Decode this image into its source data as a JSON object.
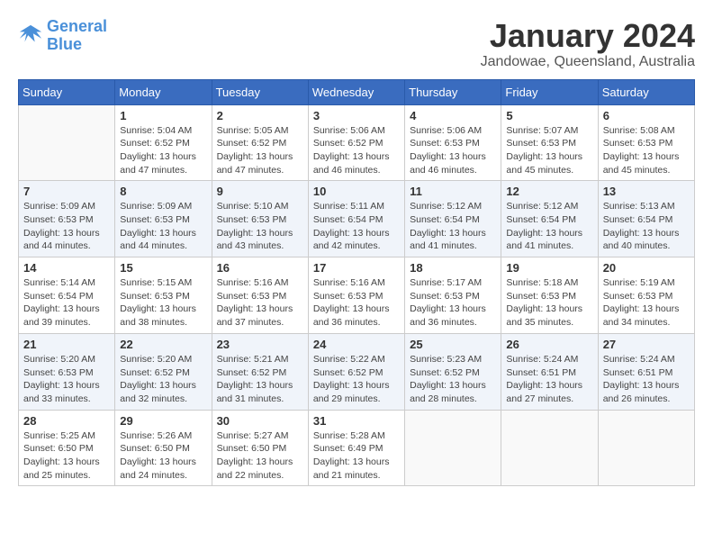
{
  "logo": {
    "text_general": "General",
    "text_blue": "Blue"
  },
  "header": {
    "title": "January 2024",
    "subtitle": "Jandowae, Queensland, Australia"
  },
  "weekdays": [
    "Sunday",
    "Monday",
    "Tuesday",
    "Wednesday",
    "Thursday",
    "Friday",
    "Saturday"
  ],
  "weeks": [
    [
      {
        "day": "",
        "sunrise": "",
        "sunset": "",
        "daylight": ""
      },
      {
        "day": "1",
        "sunrise": "Sunrise: 5:04 AM",
        "sunset": "Sunset: 6:52 PM",
        "daylight": "Daylight: 13 hours and 47 minutes."
      },
      {
        "day": "2",
        "sunrise": "Sunrise: 5:05 AM",
        "sunset": "Sunset: 6:52 PM",
        "daylight": "Daylight: 13 hours and 47 minutes."
      },
      {
        "day": "3",
        "sunrise": "Sunrise: 5:06 AM",
        "sunset": "Sunset: 6:52 PM",
        "daylight": "Daylight: 13 hours and 46 minutes."
      },
      {
        "day": "4",
        "sunrise": "Sunrise: 5:06 AM",
        "sunset": "Sunset: 6:53 PM",
        "daylight": "Daylight: 13 hours and 46 minutes."
      },
      {
        "day": "5",
        "sunrise": "Sunrise: 5:07 AM",
        "sunset": "Sunset: 6:53 PM",
        "daylight": "Daylight: 13 hours and 45 minutes."
      },
      {
        "day": "6",
        "sunrise": "Sunrise: 5:08 AM",
        "sunset": "Sunset: 6:53 PM",
        "daylight": "Daylight: 13 hours and 45 minutes."
      }
    ],
    [
      {
        "day": "7",
        "sunrise": "Sunrise: 5:09 AM",
        "sunset": "Sunset: 6:53 PM",
        "daylight": "Daylight: 13 hours and 44 minutes."
      },
      {
        "day": "8",
        "sunrise": "Sunrise: 5:09 AM",
        "sunset": "Sunset: 6:53 PM",
        "daylight": "Daylight: 13 hours and 44 minutes."
      },
      {
        "day": "9",
        "sunrise": "Sunrise: 5:10 AM",
        "sunset": "Sunset: 6:53 PM",
        "daylight": "Daylight: 13 hours and 43 minutes."
      },
      {
        "day": "10",
        "sunrise": "Sunrise: 5:11 AM",
        "sunset": "Sunset: 6:54 PM",
        "daylight": "Daylight: 13 hours and 42 minutes."
      },
      {
        "day": "11",
        "sunrise": "Sunrise: 5:12 AM",
        "sunset": "Sunset: 6:54 PM",
        "daylight": "Daylight: 13 hours and 41 minutes."
      },
      {
        "day": "12",
        "sunrise": "Sunrise: 5:12 AM",
        "sunset": "Sunset: 6:54 PM",
        "daylight": "Daylight: 13 hours and 41 minutes."
      },
      {
        "day": "13",
        "sunrise": "Sunrise: 5:13 AM",
        "sunset": "Sunset: 6:54 PM",
        "daylight": "Daylight: 13 hours and 40 minutes."
      }
    ],
    [
      {
        "day": "14",
        "sunrise": "Sunrise: 5:14 AM",
        "sunset": "Sunset: 6:54 PM",
        "daylight": "Daylight: 13 hours and 39 minutes."
      },
      {
        "day": "15",
        "sunrise": "Sunrise: 5:15 AM",
        "sunset": "Sunset: 6:53 PM",
        "daylight": "Daylight: 13 hours and 38 minutes."
      },
      {
        "day": "16",
        "sunrise": "Sunrise: 5:16 AM",
        "sunset": "Sunset: 6:53 PM",
        "daylight": "Daylight: 13 hours and 37 minutes."
      },
      {
        "day": "17",
        "sunrise": "Sunrise: 5:16 AM",
        "sunset": "Sunset: 6:53 PM",
        "daylight": "Daylight: 13 hours and 36 minutes."
      },
      {
        "day": "18",
        "sunrise": "Sunrise: 5:17 AM",
        "sunset": "Sunset: 6:53 PM",
        "daylight": "Daylight: 13 hours and 36 minutes."
      },
      {
        "day": "19",
        "sunrise": "Sunrise: 5:18 AM",
        "sunset": "Sunset: 6:53 PM",
        "daylight": "Daylight: 13 hours and 35 minutes."
      },
      {
        "day": "20",
        "sunrise": "Sunrise: 5:19 AM",
        "sunset": "Sunset: 6:53 PM",
        "daylight": "Daylight: 13 hours and 34 minutes."
      }
    ],
    [
      {
        "day": "21",
        "sunrise": "Sunrise: 5:20 AM",
        "sunset": "Sunset: 6:53 PM",
        "daylight": "Daylight: 13 hours and 33 minutes."
      },
      {
        "day": "22",
        "sunrise": "Sunrise: 5:20 AM",
        "sunset": "Sunset: 6:52 PM",
        "daylight": "Daylight: 13 hours and 32 minutes."
      },
      {
        "day": "23",
        "sunrise": "Sunrise: 5:21 AM",
        "sunset": "Sunset: 6:52 PM",
        "daylight": "Daylight: 13 hours and 31 minutes."
      },
      {
        "day": "24",
        "sunrise": "Sunrise: 5:22 AM",
        "sunset": "Sunset: 6:52 PM",
        "daylight": "Daylight: 13 hours and 29 minutes."
      },
      {
        "day": "25",
        "sunrise": "Sunrise: 5:23 AM",
        "sunset": "Sunset: 6:52 PM",
        "daylight": "Daylight: 13 hours and 28 minutes."
      },
      {
        "day": "26",
        "sunrise": "Sunrise: 5:24 AM",
        "sunset": "Sunset: 6:51 PM",
        "daylight": "Daylight: 13 hours and 27 minutes."
      },
      {
        "day": "27",
        "sunrise": "Sunrise: 5:24 AM",
        "sunset": "Sunset: 6:51 PM",
        "daylight": "Daylight: 13 hours and 26 minutes."
      }
    ],
    [
      {
        "day": "28",
        "sunrise": "Sunrise: 5:25 AM",
        "sunset": "Sunset: 6:50 PM",
        "daylight": "Daylight: 13 hours and 25 minutes."
      },
      {
        "day": "29",
        "sunrise": "Sunrise: 5:26 AM",
        "sunset": "Sunset: 6:50 PM",
        "daylight": "Daylight: 13 hours and 24 minutes."
      },
      {
        "day": "30",
        "sunrise": "Sunrise: 5:27 AM",
        "sunset": "Sunset: 6:50 PM",
        "daylight": "Daylight: 13 hours and 22 minutes."
      },
      {
        "day": "31",
        "sunrise": "Sunrise: 5:28 AM",
        "sunset": "Sunset: 6:49 PM",
        "daylight": "Daylight: 13 hours and 21 minutes."
      },
      {
        "day": "",
        "sunrise": "",
        "sunset": "",
        "daylight": ""
      },
      {
        "day": "",
        "sunrise": "",
        "sunset": "",
        "daylight": ""
      },
      {
        "day": "",
        "sunrise": "",
        "sunset": "",
        "daylight": ""
      }
    ]
  ]
}
